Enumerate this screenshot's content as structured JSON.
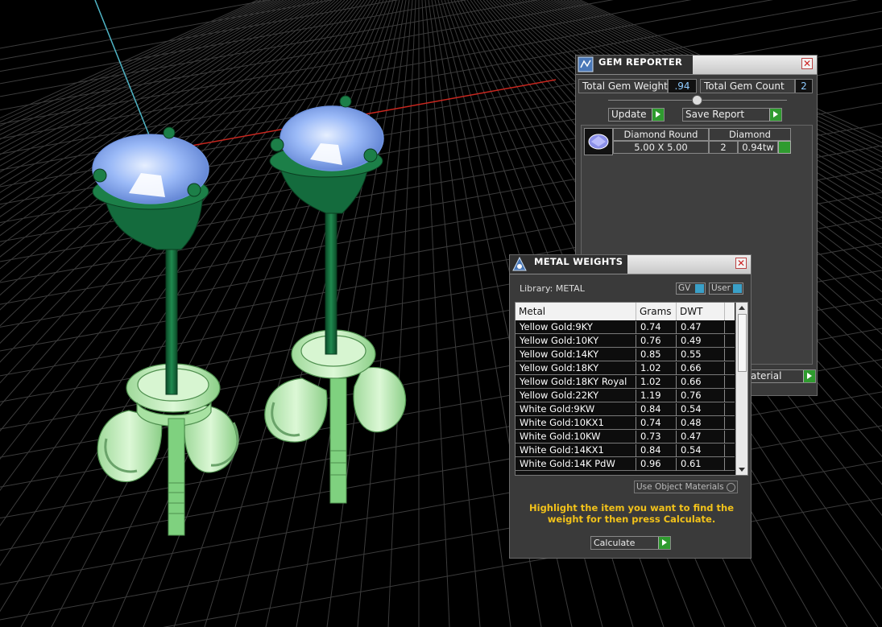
{
  "gem_reporter": {
    "title": "GEM REPORTER",
    "total_weight_label": "Total Gem Weight",
    "total_weight_value": ".94",
    "total_count_label": "Total Gem Count",
    "total_count_value": "2",
    "update_label": "Update",
    "save_report_label": "Save Report",
    "gem": {
      "shape": "Diamond Round",
      "material": "Diamond",
      "size": "5.00 X 5.00",
      "count": "2",
      "weight": "0.94tw"
    },
    "partial_button_label": "aterial"
  },
  "metal_weights": {
    "title": "METAL WEIGHTS",
    "library_label": "Library: METAL",
    "gv_label": "GV",
    "user_label": "User",
    "columns": [
      "Metal",
      "Grams",
      "DWT"
    ],
    "rows": [
      {
        "metal": "Yellow Gold:9KY",
        "grams": "0.74",
        "dwt": "0.47"
      },
      {
        "metal": "Yellow Gold:10KY",
        "grams": "0.76",
        "dwt": "0.49"
      },
      {
        "metal": "Yellow Gold:14KY",
        "grams": "0.85",
        "dwt": "0.55"
      },
      {
        "metal": "Yellow Gold:18KY",
        "grams": "1.02",
        "dwt": "0.66"
      },
      {
        "metal": "Yellow Gold:18KY Royal",
        "grams": "1.02",
        "dwt": "0.66"
      },
      {
        "metal": "Yellow Gold:22KY",
        "grams": "1.19",
        "dwt": "0.76"
      },
      {
        "metal": "White Gold:9KW",
        "grams": "0.84",
        "dwt": "0.54"
      },
      {
        "metal": "White Gold:10KX1",
        "grams": "0.74",
        "dwt": "0.48"
      },
      {
        "metal": "White Gold:10KW",
        "grams": "0.73",
        "dwt": "0.47"
      },
      {
        "metal": "White Gold:14KX1",
        "grams": "0.84",
        "dwt": "0.54"
      },
      {
        "metal": "White Gold:14K PdW",
        "grams": "0.96",
        "dwt": "0.61"
      }
    ],
    "use_object_materials_label": "Use Object Materials",
    "instruction": "Highlight the item you want to find the weight for then press Calculate.",
    "calculate_label": "Calculate"
  },
  "colors": {
    "model_dark_green": "#0f6b3c",
    "model_light_green": "#c8f2c0",
    "gem_blue": "#8fb3f5",
    "instruction_yellow": "#f2c21a",
    "go_green": "#2f9b2f"
  }
}
